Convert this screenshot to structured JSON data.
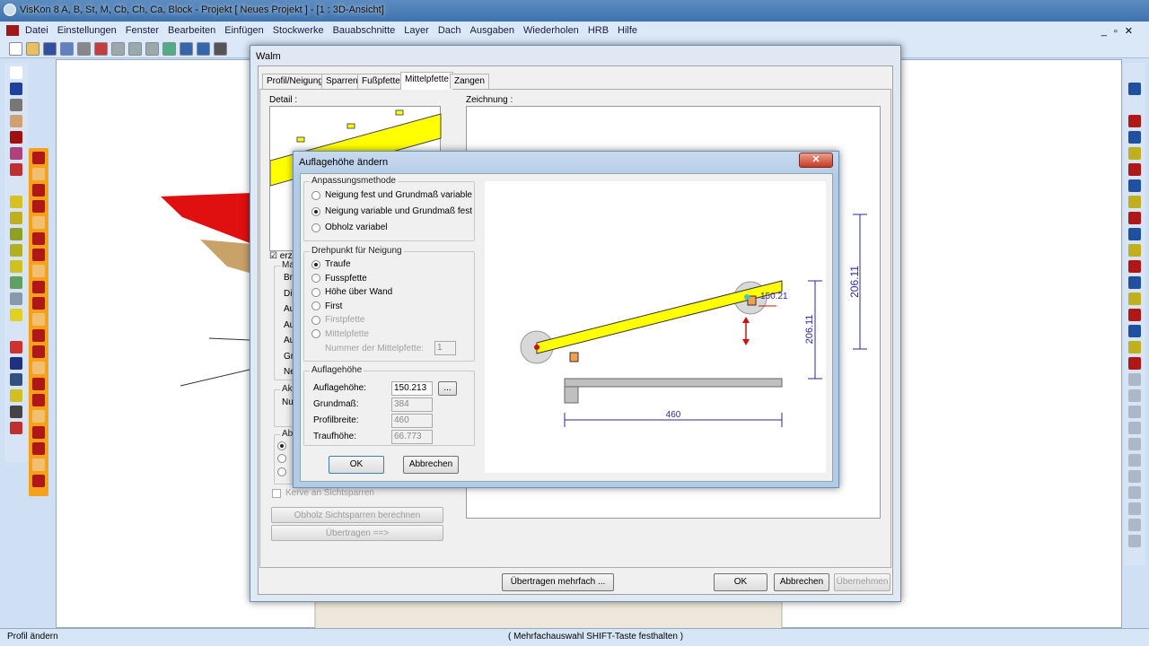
{
  "app": {
    "title": "VisKon 8 A, B, St, M, Cb, Ch, Ca, Block - Projekt [ Neues Projekt ]  - [1 : 3D-Ansicht]"
  },
  "menu": [
    "Datei",
    "Einstellungen",
    "Fenster",
    "Bearbeiten",
    "Einfügen",
    "Stockwerke",
    "Bauabschnitte",
    "Layer",
    "Dach",
    "Ausgaben",
    "Wiederholen",
    "HRB",
    "Hilfe"
  ],
  "toolbar_icons": [
    "new-icon",
    "open-icon",
    "save-icon",
    "save-all-icon",
    "print-icon",
    "print-preview-icon",
    "zoom-in-icon",
    "zoom-out-icon",
    "zoom-window-icon",
    "zoom-fit-icon",
    "undo-icon",
    "redo-icon",
    "crosshair-icon"
  ],
  "colors": {
    "accent_orange": "#f5a21a",
    "beam": "#ffff00",
    "dim": "#2a2a9a",
    "marker": "#d01010"
  },
  "walm": {
    "title": "Walm",
    "tabs": [
      "Profil/Neigung",
      "Sparren",
      "Fußpfette",
      "Mittelpfette",
      "Zangen"
    ],
    "active_tab": 3,
    "detail_label": "Detail :",
    "zeichnung_label": "Zeichnung :",
    "partial_labels": {
      "check": "erz",
      "grp1": "Maß",
      "rows": [
        "Br",
        "Di",
        "Au",
        "Au",
        "Au",
        "Gr",
        "Ne"
      ],
      "grp2": "Aktu",
      "grp2_row": "Nu",
      "grp3": "Abg"
    },
    "kerve_label": "Kerve an Sichtsparren",
    "btn_obholz": "Obholz Sichtsparren berechnen",
    "btn_uebertragen": "Übertragen ==>",
    "btn_uebertragen_mehrfach": "Übertragen mehrfach ...",
    "btn_ok": "OK",
    "btn_abbrechen": "Abbrechen",
    "btn_uebernehmen": "Übernehmen",
    "dim_bg": "206.11"
  },
  "auflage": {
    "title": "Auflagehöhe ändern",
    "grp_method": "Anpassungsmethode",
    "methods": [
      "Neigung fest und Grundmaß variable",
      "Neigung variable und Grundmaß fest",
      "Obholz variabel"
    ],
    "method_selected": 1,
    "grp_pivot": "Drehpunkt für Neigung",
    "pivots": [
      "Traufe",
      "Fusspfette",
      "Höhe über Wand",
      "First",
      "Firstpfette",
      "Mittelpfette"
    ],
    "pivot_selected": 0,
    "mittelpfette_label": "Nummer der Mittelpfette:",
    "mittelpfette_value": "1",
    "grp_height": "Auflagehöhe",
    "fields": [
      {
        "label": "Auflagehöhe:",
        "value": "150.213"
      },
      {
        "label": "Grundmaß:",
        "value": "384"
      },
      {
        "label": "Profilbreite:",
        "value": "460"
      },
      {
        "label": "Traufhöhe:",
        "value": "66.773"
      }
    ],
    "browse": "...",
    "ok": "OK",
    "cancel": "Abbrechen",
    "drawing": {
      "height_label": "150.21",
      "vertical_dim": "206.11",
      "horizontal_dim": "460"
    }
  },
  "status": {
    "left": "Profil ändern",
    "center": "( Mehrfachauswahl SHIFT-Taste festhalten )"
  }
}
